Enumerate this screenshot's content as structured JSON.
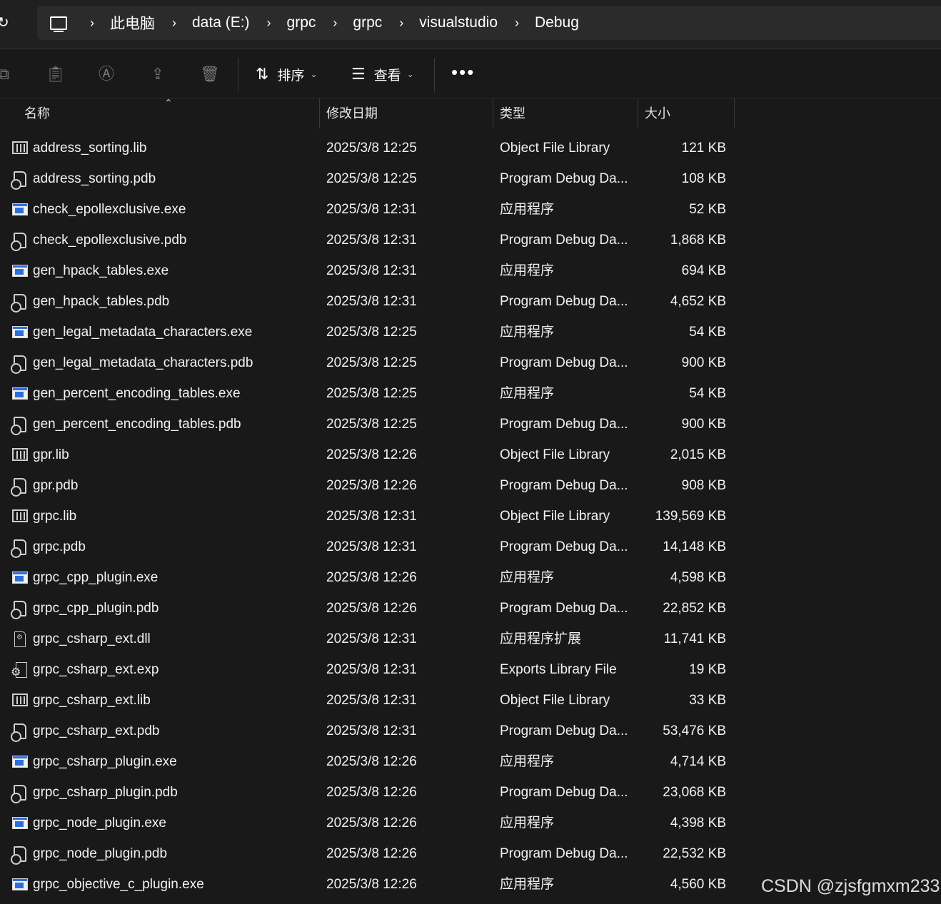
{
  "breadcrumb": [
    "此电脑",
    "data (E:)",
    "grpc",
    "grpc",
    "visualstudio",
    "Debug"
  ],
  "toolbar": {
    "sort_label": "排序",
    "view_label": "查看",
    "more_label": "•••"
  },
  "columns": {
    "name": "名称",
    "date": "修改日期",
    "type": "类型",
    "size": "大小"
  },
  "files": [
    {
      "name": "address_sorting.lib",
      "date": "2025/3/8 12:25",
      "type": "Object File Library",
      "size": "121 KB",
      "icon": "lib-icon"
    },
    {
      "name": "address_sorting.pdb",
      "date": "2025/3/8 12:25",
      "type": "Program Debug Da...",
      "size": "108 KB",
      "icon": "pdb-icon"
    },
    {
      "name": "check_epollexclusive.exe",
      "date": "2025/3/8 12:31",
      "type": "应用程序",
      "size": "52 KB",
      "icon": "exe-icon"
    },
    {
      "name": "check_epollexclusive.pdb",
      "date": "2025/3/8 12:31",
      "type": "Program Debug Da...",
      "size": "1,868 KB",
      "icon": "pdb-icon"
    },
    {
      "name": "gen_hpack_tables.exe",
      "date": "2025/3/8 12:31",
      "type": "应用程序",
      "size": "694 KB",
      "icon": "exe-icon"
    },
    {
      "name": "gen_hpack_tables.pdb",
      "date": "2025/3/8 12:31",
      "type": "Program Debug Da...",
      "size": "4,652 KB",
      "icon": "pdb-icon"
    },
    {
      "name": "gen_legal_metadata_characters.exe",
      "date": "2025/3/8 12:25",
      "type": "应用程序",
      "size": "54 KB",
      "icon": "exe-icon"
    },
    {
      "name": "gen_legal_metadata_characters.pdb",
      "date": "2025/3/8 12:25",
      "type": "Program Debug Da...",
      "size": "900 KB",
      "icon": "pdb-icon"
    },
    {
      "name": "gen_percent_encoding_tables.exe",
      "date": "2025/3/8 12:25",
      "type": "应用程序",
      "size": "54 KB",
      "icon": "exe-icon"
    },
    {
      "name": "gen_percent_encoding_tables.pdb",
      "date": "2025/3/8 12:25",
      "type": "Program Debug Da...",
      "size": "900 KB",
      "icon": "pdb-icon"
    },
    {
      "name": "gpr.lib",
      "date": "2025/3/8 12:26",
      "type": "Object File Library",
      "size": "2,015 KB",
      "icon": "lib-icon"
    },
    {
      "name": "gpr.pdb",
      "date": "2025/3/8 12:26",
      "type": "Program Debug Da...",
      "size": "908 KB",
      "icon": "pdb-icon"
    },
    {
      "name": "grpc.lib",
      "date": "2025/3/8 12:31",
      "type": "Object File Library",
      "size": "139,569 KB",
      "icon": "lib-icon"
    },
    {
      "name": "grpc.pdb",
      "date": "2025/3/8 12:31",
      "type": "Program Debug Da...",
      "size": "14,148 KB",
      "icon": "pdb-icon"
    },
    {
      "name": "grpc_cpp_plugin.exe",
      "date": "2025/3/8 12:26",
      "type": "应用程序",
      "size": "4,598 KB",
      "icon": "exe-icon"
    },
    {
      "name": "grpc_cpp_plugin.pdb",
      "date": "2025/3/8 12:26",
      "type": "Program Debug Da...",
      "size": "22,852 KB",
      "icon": "pdb-icon"
    },
    {
      "name": "grpc_csharp_ext.dll",
      "date": "2025/3/8 12:31",
      "type": "应用程序扩展",
      "size": "11,741 KB",
      "icon": "dll-icon"
    },
    {
      "name": "grpc_csharp_ext.exp",
      "date": "2025/3/8 12:31",
      "type": "Exports Library File",
      "size": "19 KB",
      "icon": "exp-icon"
    },
    {
      "name": "grpc_csharp_ext.lib",
      "date": "2025/3/8 12:31",
      "type": "Object File Library",
      "size": "33 KB",
      "icon": "lib-icon"
    },
    {
      "name": "grpc_csharp_ext.pdb",
      "date": "2025/3/8 12:31",
      "type": "Program Debug Da...",
      "size": "53,476 KB",
      "icon": "pdb-icon"
    },
    {
      "name": "grpc_csharp_plugin.exe",
      "date": "2025/3/8 12:26",
      "type": "应用程序",
      "size": "4,714 KB",
      "icon": "exe-icon"
    },
    {
      "name": "grpc_csharp_plugin.pdb",
      "date": "2025/3/8 12:26",
      "type": "Program Debug Da...",
      "size": "23,068 KB",
      "icon": "pdb-icon"
    },
    {
      "name": "grpc_node_plugin.exe",
      "date": "2025/3/8 12:26",
      "type": "应用程序",
      "size": "4,398 KB",
      "icon": "exe-icon"
    },
    {
      "name": "grpc_node_plugin.pdb",
      "date": "2025/3/8 12:26",
      "type": "Program Debug Da...",
      "size": "22,532 KB",
      "icon": "pdb-icon"
    },
    {
      "name": "grpc_objective_c_plugin.exe",
      "date": "2025/3/8 12:26",
      "type": "应用程序",
      "size": "4,560 KB",
      "icon": "exe-icon"
    }
  ],
  "watermark": "CSDN @zjsfgmxm233",
  "colors": {
    "background": "#191919",
    "toolbar": "#202020",
    "addressbar": "#2b2b2b",
    "exe_blue": "#2f6ed8"
  }
}
